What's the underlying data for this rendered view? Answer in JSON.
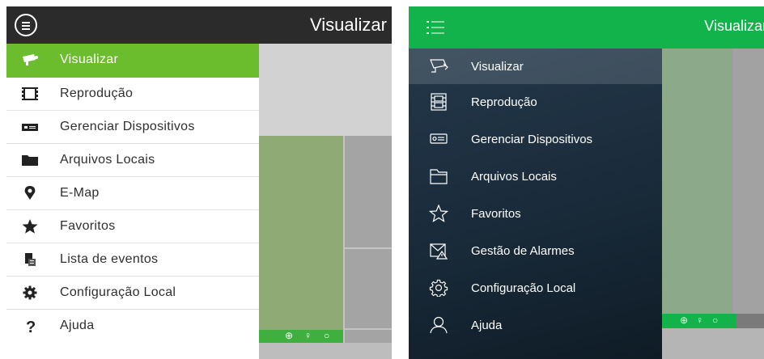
{
  "left_screen": {
    "title": "Visualizar",
    "menu": [
      {
        "label": "Visualizar",
        "icon": "camera-icon",
        "active": true
      },
      {
        "label": "Reprodução",
        "icon": "film-icon",
        "active": false
      },
      {
        "label": "Gerenciar Dispositivos",
        "icon": "dvr-icon",
        "active": false
      },
      {
        "label": "Arquivos Locais",
        "icon": "folder-icon",
        "active": false
      },
      {
        "label": "E-Map",
        "icon": "map-pin-icon",
        "active": false
      },
      {
        "label": "Favoritos",
        "icon": "star-icon",
        "active": false
      },
      {
        "label": "Lista de eventos",
        "icon": "event-list-icon",
        "active": false
      },
      {
        "label": "Configuração Local",
        "icon": "gear-icon",
        "active": false
      },
      {
        "label": "Ajuda",
        "icon": "question-icon",
        "active": false
      }
    ],
    "toolbar_glyphs": [
      "⊕",
      "♀",
      "○"
    ],
    "colors": {
      "header": "#2b2b2b",
      "accent": "#6cbd2e"
    }
  },
  "right_screen": {
    "title": "Visualizar",
    "menu": [
      {
        "label": "Visualizar",
        "icon": "camera-outline-icon",
        "active": true
      },
      {
        "label": "Reprodução",
        "icon": "film-outline-icon",
        "active": false
      },
      {
        "label": "Gerenciar Dispositivos",
        "icon": "dvr-outline-icon",
        "active": false
      },
      {
        "label": "Arquivos Locais",
        "icon": "folder-outline-icon",
        "active": false
      },
      {
        "label": "Favoritos",
        "icon": "star-outline-icon",
        "active": false
      },
      {
        "label": "Gestão de Alarmes",
        "icon": "alarm-mail-icon",
        "active": false
      },
      {
        "label": "Configuração Local",
        "icon": "gear-outline-icon",
        "active": false
      },
      {
        "label": "Ajuda",
        "icon": "user-outline-icon",
        "active": false
      }
    ],
    "toolbar_glyphs": [
      "⊕",
      "♀",
      "○"
    ],
    "colors": {
      "header": "#13b34b",
      "drawer": "#1b2d3d"
    }
  }
}
